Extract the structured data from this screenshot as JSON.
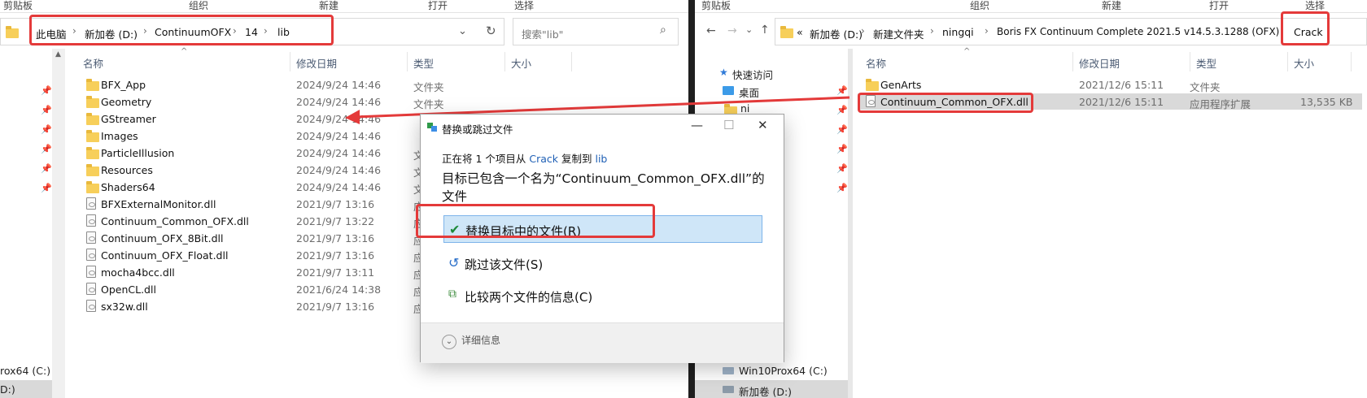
{
  "left": {
    "ribbon": [
      "剪贴板",
      "组织",
      "新建",
      "打开",
      "选择"
    ],
    "breadcrumb": [
      "此电脑",
      "新加卷 (D:)",
      "ContinuumOFX",
      "14",
      "lib"
    ],
    "search_placeholder": "搜索\"lib\"",
    "columns": {
      "name": "名称",
      "date": "修改日期",
      "type": "类型",
      "size": "大小"
    },
    "rows": [
      {
        "name": "BFX_App",
        "date": "2024/9/24 14:46",
        "type": "文件夹",
        "kind": "folder"
      },
      {
        "name": "Geometry",
        "date": "2024/9/24 14:46",
        "type": "文件夹",
        "kind": "folder"
      },
      {
        "name": "GStreamer",
        "date": "2024/9/24 14:46",
        "type": "",
        "kind": "folder"
      },
      {
        "name": "Images",
        "date": "2024/9/24 14:46",
        "type": "",
        "kind": "folder"
      },
      {
        "name": "ParticleIllusion",
        "date": "2024/9/24 14:46",
        "type": "文",
        "kind": "folder"
      },
      {
        "name": "Resources",
        "date": "2024/9/24 14:46",
        "type": "文",
        "kind": "folder"
      },
      {
        "name": "Shaders64",
        "date": "2024/9/24 14:46",
        "type": "文",
        "kind": "folder"
      },
      {
        "name": "BFXExternalMonitor.dll",
        "date": "2021/9/7 13:16",
        "type": "应",
        "kind": "file"
      },
      {
        "name": "Continuum_Common_OFX.dll",
        "date": "2021/9/7 13:22",
        "type": "应",
        "kind": "file"
      },
      {
        "name": "Continuum_OFX_8Bit.dll",
        "date": "2021/9/7 13:16",
        "type": "应",
        "kind": "file"
      },
      {
        "name": "Continuum_OFX_Float.dll",
        "date": "2021/9/7 13:16",
        "type": "应",
        "kind": "file"
      },
      {
        "name": "mocha4bcc.dll",
        "date": "2021/9/7 13:11",
        "type": "应",
        "kind": "file"
      },
      {
        "name": "OpenCL.dll",
        "date": "2021/6/24 14:38",
        "type": "应",
        "kind": "file"
      },
      {
        "name": "sx32w.dll",
        "date": "2021/9/7 13:16",
        "type": "应",
        "kind": "file"
      }
    ],
    "nav_bottom": [
      "rox64 (C:)",
      "D:)"
    ]
  },
  "right": {
    "ribbon": [
      "剪贴板",
      "组织",
      "新建",
      "打开",
      "选择"
    ],
    "breadcrumb": [
      "新加卷 (D:)",
      "新建文件夹",
      "ningqi",
      "Boris FX Continuum Complete 2021.5 v14.5.3.1288 (OFX)",
      "Crack"
    ],
    "breadcrumb_prefix": "«",
    "columns": {
      "name": "名称",
      "date": "修改日期",
      "type": "类型",
      "size": "大小"
    },
    "rows": [
      {
        "name": "GenArts",
        "date": "2021/12/6 15:11",
        "type": "文件夹",
        "size": "",
        "kind": "folder"
      },
      {
        "name": "Continuum_Common_OFX.dll",
        "date": "2021/12/6 15:11",
        "type": "应用程序扩展",
        "size": "13,535 KB",
        "kind": "file",
        "selected": true
      }
    ],
    "nav": [
      "快速访问",
      "桌面",
      "ni"
    ],
    "nav_bottom": [
      "Win10Prox64 (C:)",
      "新加卷 (D:)"
    ]
  },
  "dialog": {
    "title": "替换或跳过文件",
    "line1_prefix": "正在将 1 个项目从 ",
    "line1_src": "Crack",
    "line1_mid": " 复制到 ",
    "line1_dst": "lib",
    "headline": "目标已包含一个名为“Continuum_Common_OFX.dll”的文件",
    "opt_replace": "替换目标中的文件(R)",
    "opt_skip": "跳过该文件(S)",
    "opt_compare": "比较两个文件的信息(C)",
    "details": "详细信息"
  },
  "colors": {
    "highlight_box": "#e43a3a",
    "link": "#1e5fb5",
    "selection": "#cfe6f8"
  }
}
